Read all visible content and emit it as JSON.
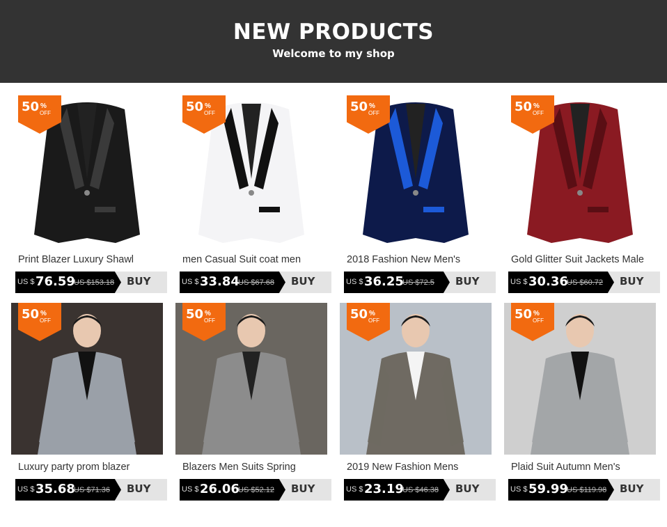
{
  "header": {
    "title": "NEW PRODUCTS",
    "subtitle": "Welcome to my shop"
  },
  "badge": {
    "num": "50",
    "pct": "%",
    "off": "OFF"
  },
  "currency": "US $",
  "buy_label": "BUY",
  "products": [
    {
      "title": "Print Blazer Luxury Shawl",
      "price": "76.59",
      "old": "US $153.18",
      "jacket": "#1a1a1a",
      "accent": "#3a3a3a",
      "bg": "#ffffff",
      "person": false
    },
    {
      "title": "men Casual Suit coat men",
      "price": "33.84",
      "old": "US $67.68",
      "jacket": "#f4f4f6",
      "accent": "#111111",
      "bg": "#ffffff",
      "person": false
    },
    {
      "title": "2018 Fashion New Men's",
      "price": "36.25",
      "old": "US $72.5",
      "jacket": "#0d1a4a",
      "accent": "#1c5ad8",
      "bg": "#ffffff",
      "person": false
    },
    {
      "title": "Gold Glitter Suit Jackets Male",
      "price": "30.36",
      "old": "US $60.72",
      "jacket": "#8a1a22",
      "accent": "#5a0e14",
      "bg": "#ffffff",
      "person": false
    },
    {
      "title": "Luxury party prom blazer",
      "price": "35.68",
      "old": "US $71.36",
      "jacket": "#9aa0a8",
      "accent": "#111111",
      "bg": "#3a3330",
      "person": true
    },
    {
      "title": "Blazers Men Suits Spring",
      "price": "26.06",
      "old": "US $52.12",
      "jacket": "#8c8c8c",
      "accent": "#222222",
      "bg": "#6a6660",
      "person": true
    },
    {
      "title": "2019 New Fashion Mens",
      "price": "23.19",
      "old": "US $46.38",
      "jacket": "#6f6a62",
      "accent": "#f4f4f4",
      "bg": "#b9c0c8",
      "person": true
    },
    {
      "title": "Plaid Suit Autumn Men's",
      "price": "59.99",
      "old": "US $119.98",
      "jacket": "#a3a6a8",
      "accent": "#111111",
      "bg": "#cfcfcf",
      "person": true
    }
  ]
}
